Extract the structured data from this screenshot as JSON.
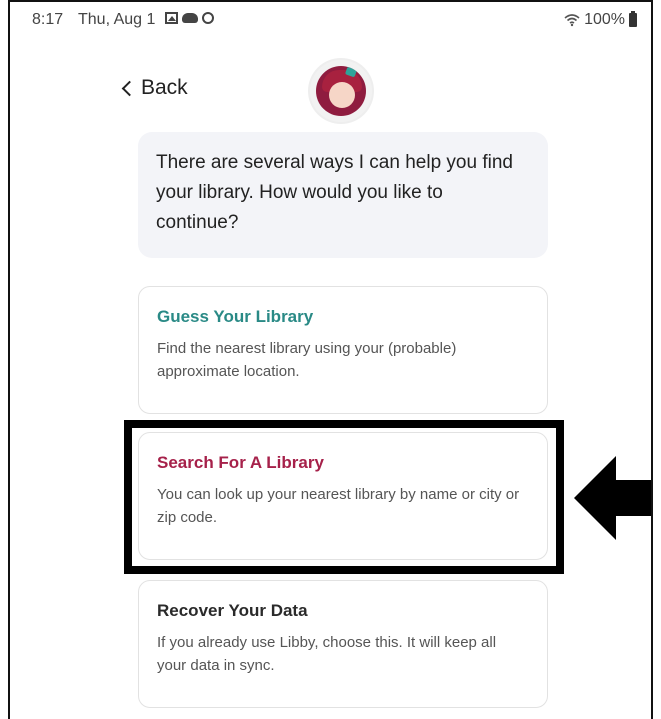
{
  "status_bar": {
    "time": "8:17",
    "date": "Thu, Aug 1",
    "battery": "100%"
  },
  "header": {
    "back_label": "Back"
  },
  "prompt": {
    "text": "There are several ways I can help you find your library. How would you like to continue?"
  },
  "options": [
    {
      "title": "Guess Your Library",
      "description": "Find the nearest library using your (probable) approximate location.",
      "color": "#2a8a86"
    },
    {
      "title": "Search For A Library",
      "description": "You can look up your nearest library by name or city or zip code.",
      "color": "#a6214a"
    },
    {
      "title": "Recover Your Data",
      "description": "If you already use Libby, choose this. It will keep all your data in sync.",
      "color": "#2a2a2a"
    }
  ],
  "colors": {
    "guess_accent": "#2a8a86",
    "search_accent": "#a6214a",
    "logo_background": "#8f1c3f",
    "bubble_background": "#f3f4f8",
    "annotation": "#000000"
  },
  "icons": {
    "back": "chevron-left-icon",
    "logo": "libby-logo-icon",
    "annotation": "arrow-left-icon"
  }
}
